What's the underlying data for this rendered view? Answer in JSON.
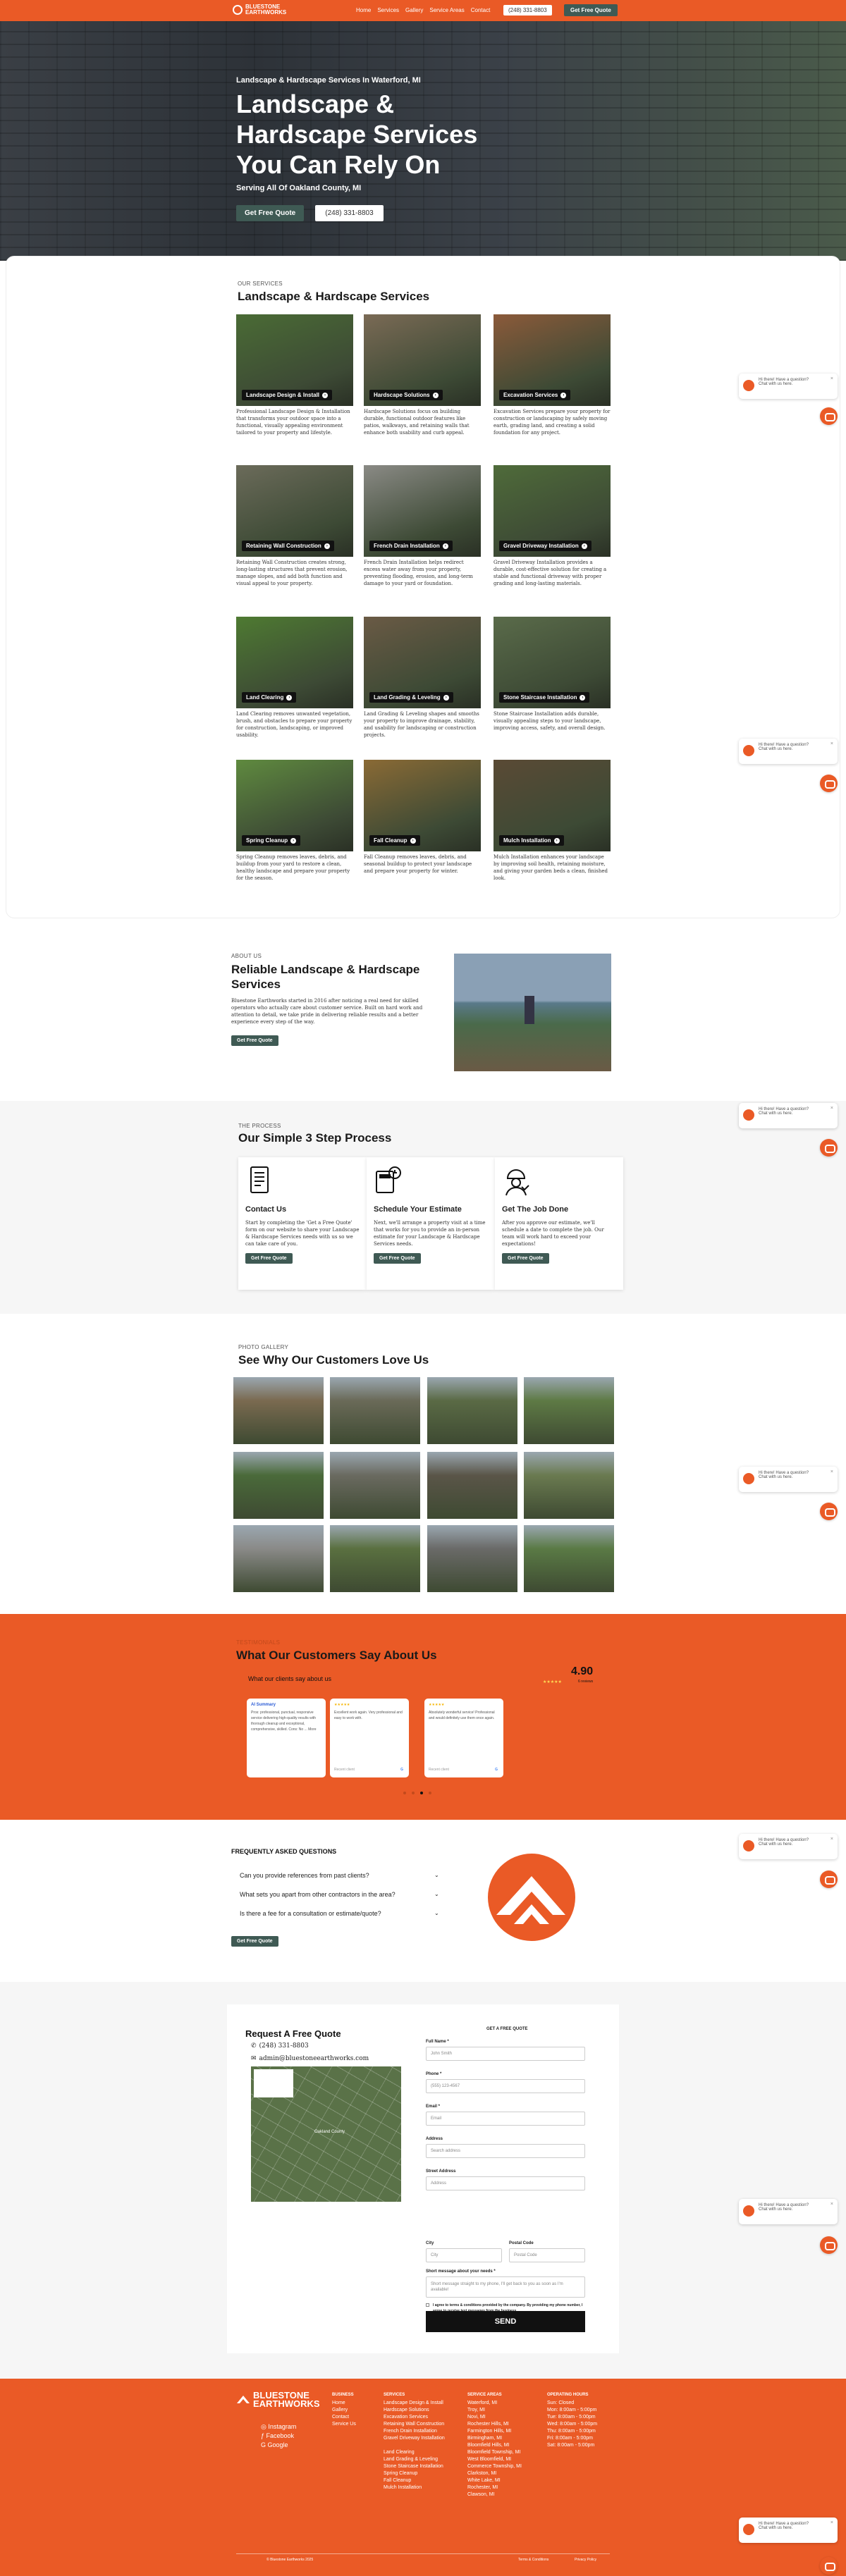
{
  "header": {
    "logo_text_1": "BLUESTONE",
    "logo_text_2": "EARTHWORKS",
    "nav": [
      "Home",
      "Services",
      "Gallery",
      "Service Areas",
      "Contact"
    ],
    "phone": "(248) 331-8803",
    "cta": "Get Free Quote"
  },
  "hero": {
    "subtitle": "Landscape & Hardscape Services In Waterford, MI",
    "title": "Landscape & Hardscape Services You Can Rely On",
    "serving": "Serving All Of Oakland County, MI",
    "cta": "Get Free Quote",
    "phone": "(248) 331-8803"
  },
  "services": {
    "label": "OUR SERVICES",
    "title": "Landscape & Hardscape Services",
    "items": [
      {
        "name": "Landscape Design & Install",
        "desc": "Professional Landscape Design & Installation that transforms your outdoor space into a functional, visually appealing environment tailored to your property and lifestyle.",
        "color": "#4a6b35"
      },
      {
        "name": "Hardscape Solutions",
        "desc": "Hardscape Solutions focus on building durable, functional outdoor features like patios, walkways, and retaining walls that enhance both usability and curb appeal.",
        "color": "#7a6a55"
      },
      {
        "name": "Excavation Services",
        "desc": "Excavation Services prepare your property for construction or landscaping by safely moving earth, grading land, and creating a solid foundation for any project.",
        "color": "#8b5a3a"
      },
      {
        "name": "Retaining Wall Construction",
        "desc": "Retaining Wall Construction creates strong, long-lasting structures that prevent erosion, manage slopes, and add both function and visual appeal to your property.",
        "color": "#6b6b5a"
      },
      {
        "name": "French Drain Installation",
        "desc": "French Drain Installation helps redirect excess water away from your property, preventing flooding, erosion, and long-term damage to your yard or foundation.",
        "color": "#8a8a85"
      },
      {
        "name": "Gravel Driveway Installation",
        "desc": "Gravel Driveway Installation provides a durable, cost-effective solution for creating a stable and functional driveway with proper grading and long-lasting materials.",
        "color": "#4f6b3a"
      },
      {
        "name": "Land Clearing",
        "desc": "Land Clearing removes unwanted vegetation, brush, and obstacles to prepare your property for construction, landscaping, or improved usability.",
        "color": "#4e7a32"
      },
      {
        "name": "Land Grading & Leveling",
        "desc": "Land Grading & Leveling shapes and smooths your property to improve drainage, stability, and usability for landscaping or construction projects.",
        "color": "#6a5a45"
      },
      {
        "name": "Stone Staircase Installation",
        "desc": "Stone Staircase Installation adds durable, visually appealing steps to your landscape, improving access, safety, and overall design.",
        "color": "#5a6b4a"
      },
      {
        "name": "Spring Cleanup",
        "desc": "Spring Cleanup removes leaves, debris, and buildup from your yard to restore a clean, healthy landscape and prepare your property for the season.",
        "color": "#5f8a3f"
      },
      {
        "name": "Fall Cleanup",
        "desc": "Fall Cleanup removes leaves, debris, and seasonal buildup to protect your landscape and prepare your property for winter.",
        "color": "#8a6a35"
      },
      {
        "name": "Mulch Installation",
        "desc": "Mulch Installation enhances your landscape by improving soil health, retaining moisture, and giving your garden beds a clean, finished look.",
        "color": "#5a4a35"
      }
    ]
  },
  "about": {
    "label": "ABOUT US",
    "title": "Reliable Landscape & Hardscape Services",
    "body": "Bluestone Earthworks started in 2016 after noticing a real need for skilled operators who actually care about customer service. Built on hard work and attention to detail, we take pride in delivering reliable results and a better experience every step of the way.",
    "cta": "Get Free Quote"
  },
  "process": {
    "label": "THE PROCESS",
    "title": "Our Simple 3 Step Process",
    "steps": [
      {
        "title": "Contact Us",
        "desc": "Start by completing the 'Get a Free Quote' form on our website to share your Landscape & Hardscape Services needs with us so we can take care of you.",
        "cta": "Get Free Quote"
      },
      {
        "title": "Schedule Your Estimate",
        "desc": "Next, we'll arrange a property visit at a time that works for you to provide an in-person estimate for your Landscape & Hardscape Services needs.",
        "cta": "Get Free Quote"
      },
      {
        "title": "Get The Job Done",
        "desc": "After you approve our estimate, we'll schedule a date to complete the job. Our team will work hard to exceed your expectations!",
        "cta": "Get Free Quote"
      }
    ]
  },
  "gallery": {
    "label": "PHOTO GALLERY",
    "title": "See Why Our Customers Love Us",
    "tiles": [
      "#7a6a50",
      "#6a6a58",
      "#5a6a45",
      "#5e7a45",
      "#4a6a3a",
      "#6a6a60",
      "#5a5548",
      "#6a7a50",
      "#8a8a88",
      "#5a7040",
      "#6a6a68",
      "#5a7a45"
    ]
  },
  "testimonials": {
    "label": "TESTIMONIALS",
    "title": "What Our Customers Say About Us",
    "subtitle": "What our clients say about us",
    "rating": "4.90",
    "rating_count": "6 reviews",
    "summary_title": "AI Summary",
    "summary": "Pros: professional, punctual, responsive service delivering high-quality results with thorough cleanup and exceptional, comprehensive, skilled. Cons: No ... More",
    "cards": [
      {
        "text": "Excellent work again. Very professional and easy to work with.",
        "name": "Recent client"
      },
      {
        "text": "Absolutely wonderful service! Professional and would definitely use them once again.",
        "name": "Recent client"
      }
    ]
  },
  "faq": {
    "label": "FREQUENTLY ASKED QUESTIONS",
    "questions": [
      "Can you provide references from past clients?",
      "What sets you apart from other contractors in the area?",
      "Is there a fee for a consultation or estimate/quote?"
    ],
    "cta": "Get Free Quote"
  },
  "contact": {
    "title": "Request A Free Quote",
    "phone": "(248) 331-8803",
    "email": "admin@bluestoneearthworks.com",
    "map_label": "Oakland County",
    "form_title": "GET A FREE QUOTE",
    "fields": [
      {
        "label": "Full Name *",
        "placeholder": "John Smith"
      },
      {
        "label": "Phone *",
        "placeholder": "(555) 123-4567"
      },
      {
        "label": "Email *",
        "placeholder": "Email"
      },
      {
        "label": "Address",
        "placeholder": "Search address"
      },
      {
        "label": "Street Address",
        "placeholder": "Address"
      }
    ],
    "city_label": "City",
    "city_placeholder": "City",
    "zip_label": "Postal Code",
    "zip_placeholder": "Postal Code",
    "message_label": "Short message about your needs *",
    "message_placeholder": "Short message straight to my phone, I'll get back to you as soon as I'm available!",
    "consent": "I agree to terms & conditions provided by the company. By providing my phone number, I agree to receive text messages from the business.",
    "submit": "SEND"
  },
  "footer": {
    "social": [
      "Instagram",
      "Facebook",
      "Google"
    ],
    "business_title": "BUSINESS",
    "business": [
      "Home",
      "Gallery",
      "Contact",
      "Service Us"
    ],
    "services_title": "SERVICES",
    "services": [
      "Landscape Design & Install",
      "Hardscape Solutions",
      "Excavation Services",
      "Retaining Wall Construction",
      "French Drain Installation",
      "Gravel Driveway Installation",
      "",
      "Land Clearing",
      "Land Grading & Leveling",
      "Stone Staircase Installation",
      "Spring Cleanup",
      "Fall Cleanup",
      "Mulch Installation"
    ],
    "areas_title": "SERVICE AREAS",
    "areas": [
      "Waterford, MI",
      "Troy, MI",
      "Novi, MI",
      "Rochester Hills, MI",
      "Farmington Hills, MI",
      "Birmingham, MI",
      "Bloomfield Hills, MI",
      "Bloomfield Township, MI",
      "West Bloomfield, MI",
      "Commerce Township, MI",
      "Clarkston, MI",
      "White Lake, MI",
      "Rochester, MI",
      "Clawson, MI"
    ],
    "hours_title": "OPERATING HOURS",
    "hours": [
      "Sun: Closed",
      "Mon: 8:00am - 5:00pm",
      "Tue: 8:00am - 5:00pm",
      "Wed: 8:00am - 5:00pm",
      "Thu: 8:00am - 5:00pm",
      "Fri: 8:00am - 5:00pm",
      "Sat: 8:00am - 5:00pm"
    ],
    "copyright": "© Bluestone Earthworks 2025",
    "terms": "Terms & Conditions",
    "privacy": "Privacy Policy"
  },
  "chat": {
    "line1": "Hi there! Have a question?",
    "line2": "Chat with us here."
  }
}
